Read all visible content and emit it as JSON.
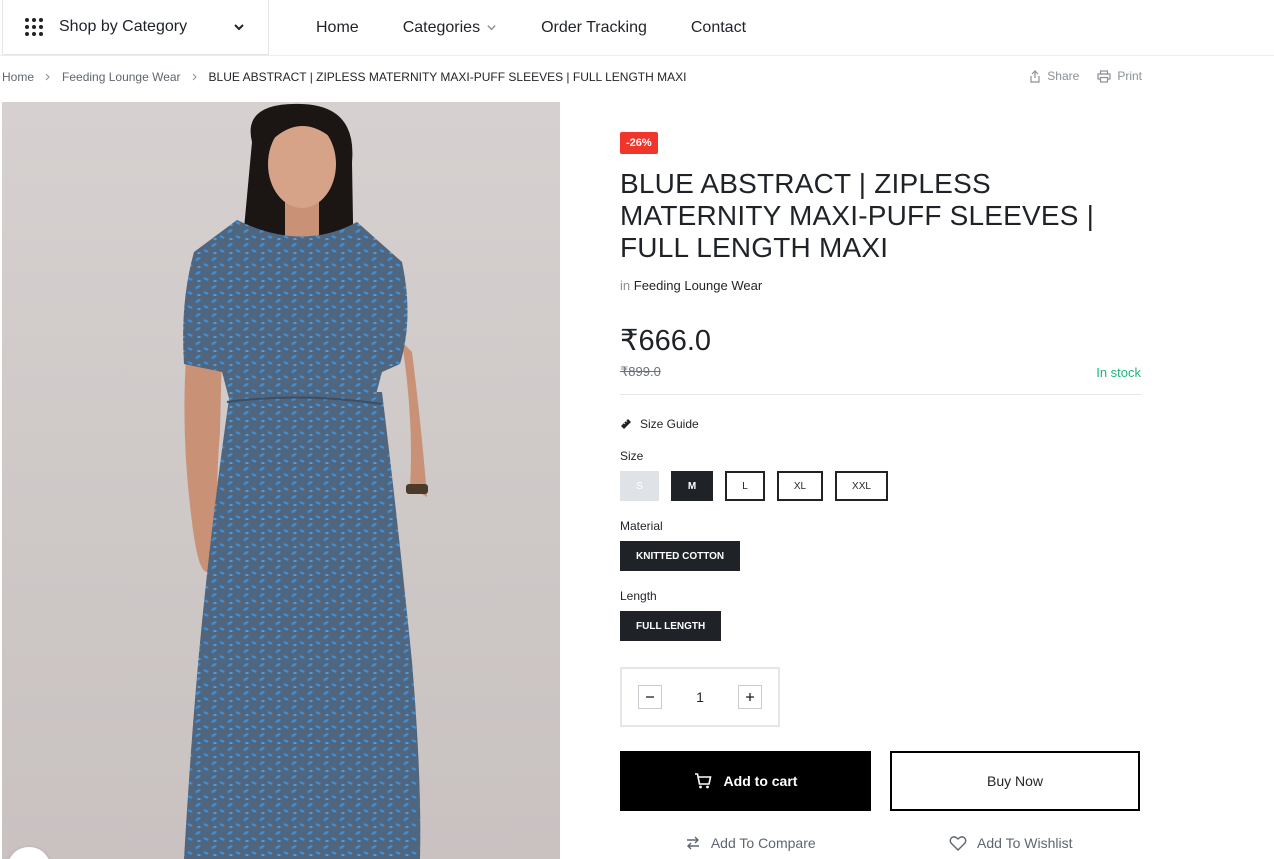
{
  "header": {
    "shop_by_category": "Shop by Category",
    "nav": [
      "Home",
      "Categories",
      "Order Tracking",
      "Contact"
    ]
  },
  "breadcrumb": {
    "items": [
      "Home",
      "Feeding Lounge Wear"
    ],
    "current": "BLUE ABSTRACT | ZIPLESS MATERNITY MAXI-PUFF SLEEVES | FULL LENGTH MAXI"
  },
  "page_actions": {
    "share": "Share",
    "print": "Print"
  },
  "product": {
    "discount": "-26%",
    "title": "BLUE ABSTRACT | ZIPLESS MATERNITY MAXI-PUFF SLEEVES | FULL LENGTH MAXI",
    "in_label": "in",
    "category": "Feeding Lounge Wear",
    "price": "₹666.0",
    "old_price": "₹899.0",
    "stock": "In stock",
    "size_guide": "Size Guide",
    "size_label": "Size",
    "sizes": [
      "S",
      "M",
      "L",
      "XL",
      "XXL"
    ],
    "selected_size": "M",
    "unavailable_size": "S",
    "material_label": "Material",
    "material": "KNITTED COTTON",
    "length_label": "Length",
    "length": "FULL LENGTH",
    "quantity": "1",
    "add_to_cart": "Add to cart",
    "buy_now": "Buy Now",
    "add_to_compare": "Add To Compare",
    "add_to_wishlist": "Add To Wishlist"
  },
  "colors": {
    "discount_badge": "#f1352a",
    "in_stock": "#1fb67a",
    "primary_button": "#000000",
    "dress_base": "#4a6a8f",
    "dress_pattern": "#3c8fd8"
  },
  "icons": {
    "menu": "grid-dots-icon",
    "share": "share-icon",
    "print": "printer-icon",
    "size_guide": "ruler-icon",
    "cart": "cart-icon",
    "compare": "compare-arrows-icon",
    "wishlist": "heart-icon",
    "expand": "expand-icon"
  }
}
